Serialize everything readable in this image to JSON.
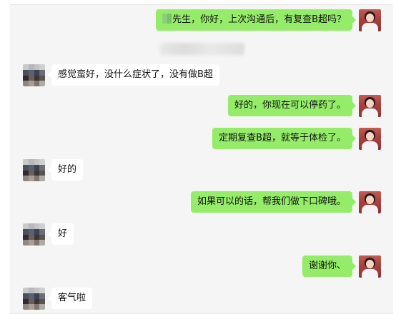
{
  "messages": [
    {
      "side": "right",
      "text": "先生，你好，上次沟通后，有复查B超吗？",
      "masked_prefix": true
    },
    {
      "side": "left",
      "text": "感觉蛮好，没什么症状了，没有做B超"
    },
    {
      "side": "right",
      "text": "好的，你现在可以停药了。"
    },
    {
      "side": "right",
      "text": "定期复查B超，就等于体检了。"
    },
    {
      "side": "left",
      "text": "好的"
    },
    {
      "side": "right",
      "text": "如果可以的话，帮我们做下口碑哦。"
    },
    {
      "side": "left",
      "text": "好"
    },
    {
      "side": "right",
      "text": "谢谢你、"
    },
    {
      "side": "left",
      "text": "客气啦"
    }
  ],
  "colors": {
    "my_bubble": "#95ec69",
    "their_bubble": "#ffffff",
    "chat_background": "#f5f5f5"
  },
  "avatars": {
    "doctor": "doctor-avatar-icon",
    "patient": "pixelated-avatar-icon"
  }
}
